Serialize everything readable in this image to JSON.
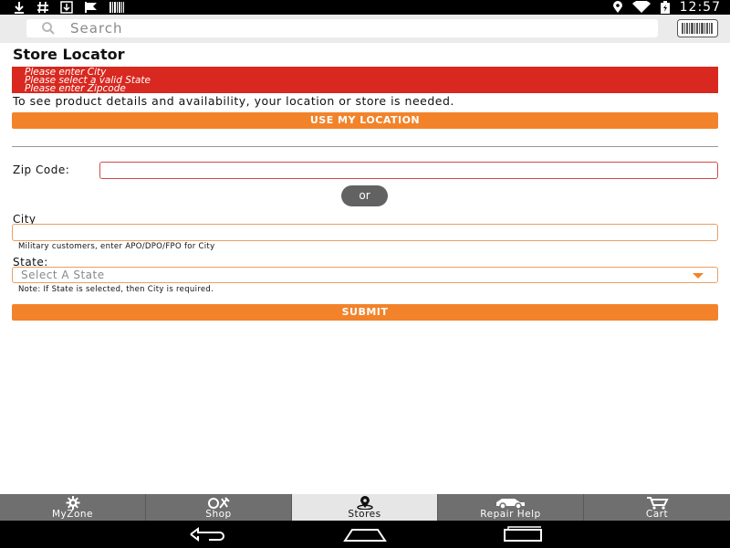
{
  "status_bar": {
    "time": "12:57",
    "left_icons": [
      "download-icon",
      "hash-icon",
      "download-box-icon",
      "flag-icon",
      "barcode-small-icon"
    ],
    "right_icons": [
      "location-icon",
      "wifi-icon",
      "battery-icon"
    ]
  },
  "search": {
    "placeholder": "Search",
    "barcode_icon": "barcode-scanner-icon"
  },
  "page": {
    "title": "Store Locator",
    "errors": [
      "Please enter City",
      "Please select a valid State",
      "Please enter Zipcode"
    ],
    "info_text": "To see product details and availability, your location or store is needed.",
    "use_location_label": "USE MY LOCATION"
  },
  "form": {
    "zip_label": "Zip Code:",
    "zip_value": "",
    "or_label": "or",
    "city_label": "City",
    "city_value": "",
    "city_hint": "Military customers, enter APO/DPO/FPO for City",
    "state_label": "State:",
    "state_selected": "Select A State",
    "state_hint": "Note: If State is selected, then City is required.",
    "submit_label": "SUBMIT"
  },
  "colors": {
    "accent": "#f2832a",
    "error": "#d8281f",
    "tab_bg": "#6f6f6f",
    "tab_active_bg": "#e6e6e6"
  },
  "tabs": [
    {
      "label": "MyZone",
      "icon": "gear-icon",
      "active": false
    },
    {
      "label": "Shop",
      "icon": "tools-icon",
      "active": false
    },
    {
      "label": "Stores",
      "icon": "map-pin-icon",
      "active": true
    },
    {
      "label": "Repair Help",
      "icon": "car-icon",
      "active": false
    },
    {
      "label": "Cart",
      "icon": "cart-icon",
      "active": false
    }
  ],
  "nav": {
    "icons": [
      "back-icon",
      "home-icon",
      "recents-icon"
    ]
  }
}
